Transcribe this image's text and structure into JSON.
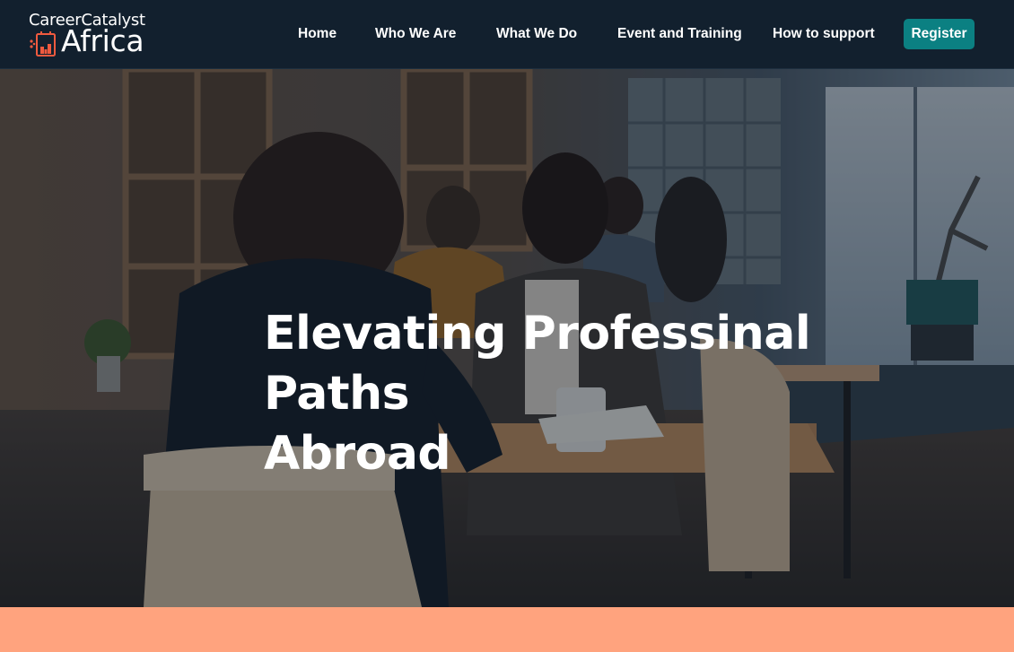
{
  "brand": {
    "name_top": "CareerCatalyst",
    "name_bottom": "Africa",
    "icon": "city-building-icon",
    "colors": {
      "navbar": "#12202e",
      "accent": "#0b8082",
      "logo_icon": "#ef5a3f",
      "band": "#ffa37e"
    }
  },
  "nav": {
    "items": [
      {
        "label": "Home"
      },
      {
        "label": "Who We Are"
      },
      {
        "label": "What We Do"
      },
      {
        "label": "Event and Training"
      },
      {
        "label": "How to support"
      }
    ],
    "register_label": "Register"
  },
  "hero": {
    "heading_line1": "Elevating Professinal Paths",
    "heading_line2": "Abroad",
    "image": "photo of people talking at tables in a shared workspace"
  }
}
